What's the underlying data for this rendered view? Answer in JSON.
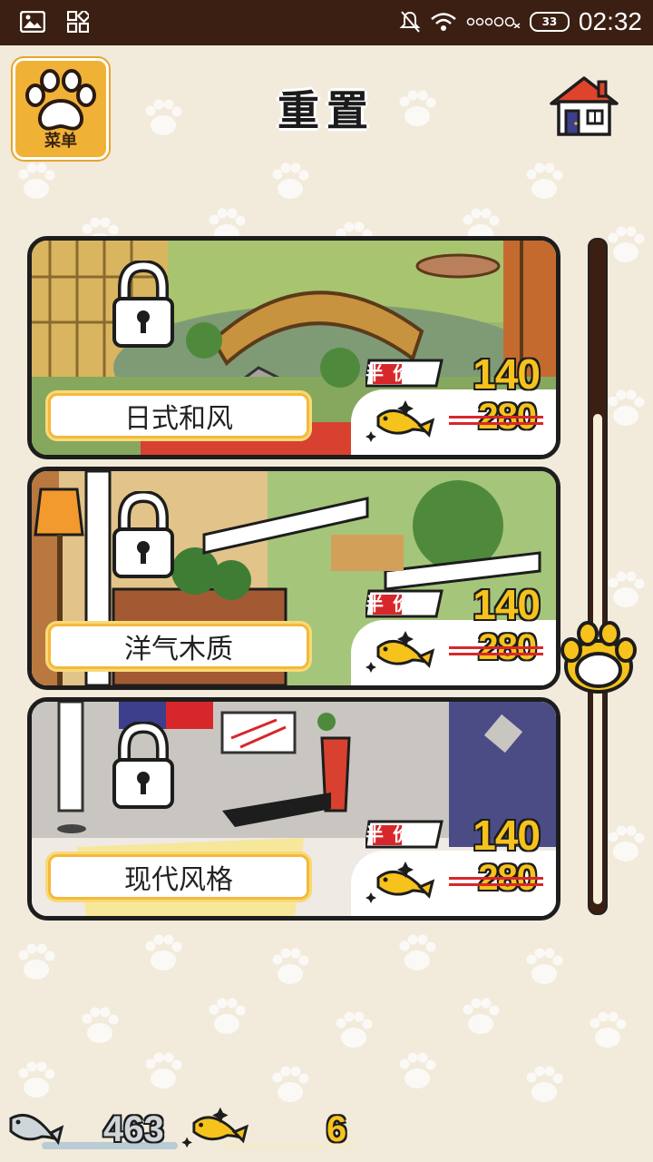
{
  "status_bar": {
    "time": "02:32",
    "battery": "33"
  },
  "header": {
    "menu_label": "菜单",
    "title": "重置"
  },
  "cards": [
    {
      "name": "日式和风",
      "banner": "半价",
      "price_new": "140",
      "price_old": "280"
    },
    {
      "name": "洋气木质",
      "banner": "半价",
      "price_new": "140",
      "price_old": "280"
    },
    {
      "name": "现代风格",
      "banner": "半价",
      "price_new": "140",
      "price_old": "280"
    }
  ],
  "currency": {
    "silver_fish": "463",
    "gold_fish": "6"
  },
  "scroll_position": 0.55
}
